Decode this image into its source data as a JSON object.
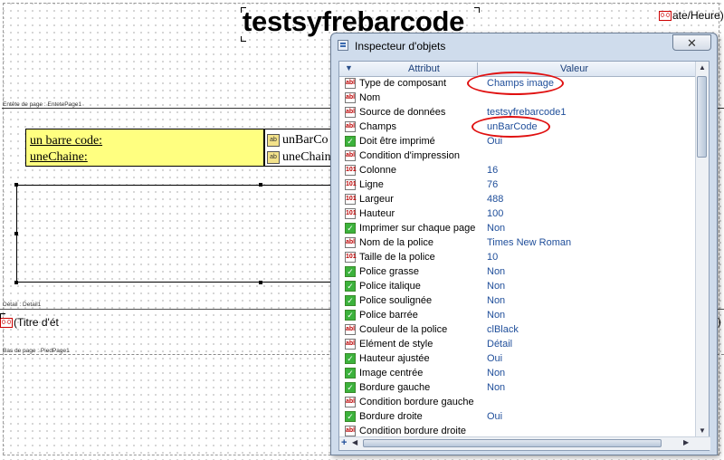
{
  "report": {
    "title": "testsyfrebarcode",
    "date_field": "ate/Heure)",
    "band_header_label": "Entête de page : EntetePage1",
    "band_detail_label": "Détail : Detail1",
    "band_footer_label": "Bas de page : PiedPage1",
    "labels": [
      "un barre code:",
      "uneChaine:"
    ],
    "fields": [
      "unBarCo",
      "uneChain"
    ],
    "titre_field": "(Titre d'ét",
    "right_marker": "#)"
  },
  "inspector": {
    "title": "Inspecteur d'objets",
    "close_glyph": "✕",
    "col_attribute": "Attribut",
    "col_value": "Valeur",
    "accent_color": "#1f4e9a",
    "highlight_color": "#e01010",
    "rows": [
      {
        "icon": "abl",
        "label": "Type de composant",
        "value": "Champs image"
      },
      {
        "icon": "abl",
        "label": "Nom",
        "value": ""
      },
      {
        "icon": "abl",
        "label": "Source de données",
        "value": "testsyfrebarcode1"
      },
      {
        "icon": "abl",
        "label": "Champs",
        "value": "unBarCode"
      },
      {
        "icon": "check",
        "label": "Doit être imprimé",
        "value": "Oui"
      },
      {
        "icon": "abl",
        "label": "Condition d'impression",
        "value": ""
      },
      {
        "icon": "num",
        "label": "Colonne",
        "value": "16"
      },
      {
        "icon": "num",
        "label": "Ligne",
        "value": "76"
      },
      {
        "icon": "num",
        "label": "Largeur",
        "value": "488"
      },
      {
        "icon": "num",
        "label": "Hauteur",
        "value": "100"
      },
      {
        "icon": "check",
        "label": "Imprimer sur chaque page",
        "value": "Non"
      },
      {
        "icon": "abl",
        "label": "Nom de la police",
        "value": "Times New Roman"
      },
      {
        "icon": "num",
        "label": "Taille de la police",
        "value": "10"
      },
      {
        "icon": "check",
        "label": "Police grasse",
        "value": "Non"
      },
      {
        "icon": "check",
        "label": "Police italique",
        "value": "Non"
      },
      {
        "icon": "check",
        "label": "Police soulignée",
        "value": "Non"
      },
      {
        "icon": "check",
        "label": "Police barrée",
        "value": "Non"
      },
      {
        "icon": "abl",
        "label": "Couleur de la police",
        "value": "clBlack"
      },
      {
        "icon": "abl",
        "label": "Elément de style",
        "value": "Détail"
      },
      {
        "icon": "check",
        "label": "Hauteur ajustée",
        "value": "Oui"
      },
      {
        "icon": "check",
        "label": "Image centrée",
        "value": "Non"
      },
      {
        "icon": "check",
        "label": "Bordure gauche",
        "value": "Non"
      },
      {
        "icon": "abl",
        "label": "Condition bordure gauche",
        "value": ""
      },
      {
        "icon": "check",
        "label": "Bordure droite",
        "value": "Oui"
      },
      {
        "icon": "abl",
        "label": "Condition bordure droite",
        "value": ""
      }
    ],
    "expand_glyph": "+"
  }
}
